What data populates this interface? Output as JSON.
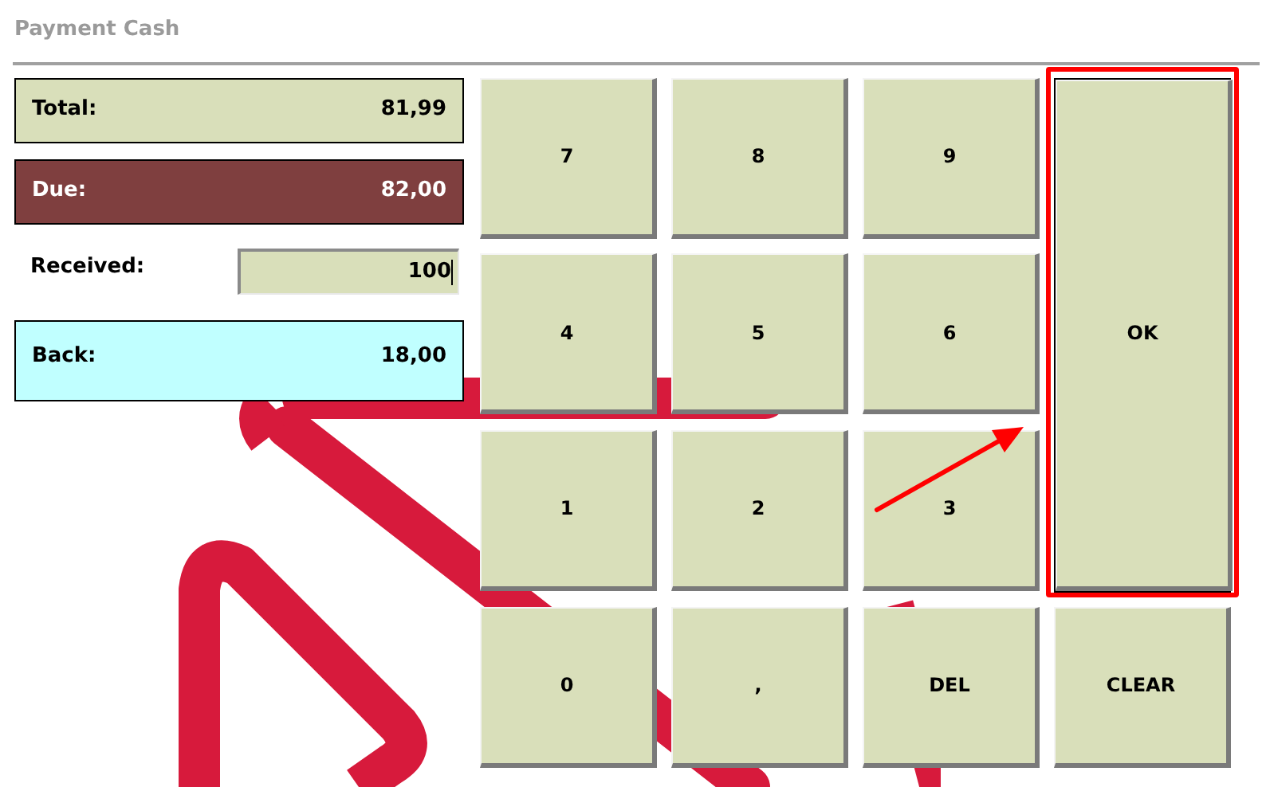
{
  "title": "Payment Cash",
  "fields": [
    {
      "kind": "total",
      "label": "Total:",
      "value": "81,99"
    },
    {
      "kind": "due",
      "label": "Due:",
      "value": "82,00"
    },
    {
      "kind": "input",
      "label": "Received:",
      "value": "100"
    },
    {
      "kind": "back",
      "label": "Back:",
      "value": "18,00"
    }
  ],
  "keys": [
    {
      "label": "7",
      "kind": "key",
      "highlighted": false
    },
    {
      "label": "8",
      "kind": "key",
      "highlighted": false
    },
    {
      "label": "9",
      "kind": "key",
      "highlighted": false
    },
    {
      "label": "4",
      "kind": "key",
      "highlighted": false
    },
    {
      "label": "5",
      "kind": "key",
      "highlighted": false
    },
    {
      "label": "6",
      "kind": "key",
      "highlighted": false
    },
    {
      "label": "OK",
      "kind": "tall",
      "highlighted": true
    },
    {
      "label": "1",
      "kind": "key",
      "highlighted": false
    },
    {
      "label": "2",
      "kind": "key",
      "highlighted": false
    },
    {
      "label": "3",
      "kind": "key",
      "highlighted": false
    },
    {
      "label": "0",
      "kind": "key",
      "highlighted": false
    },
    {
      "label": ",",
      "kind": "key",
      "highlighted": false
    },
    {
      "label": "DEL",
      "kind": "key",
      "highlighted": false
    },
    {
      "label": "CLEAR",
      "kind": "key",
      "highlighted": false
    }
  ]
}
